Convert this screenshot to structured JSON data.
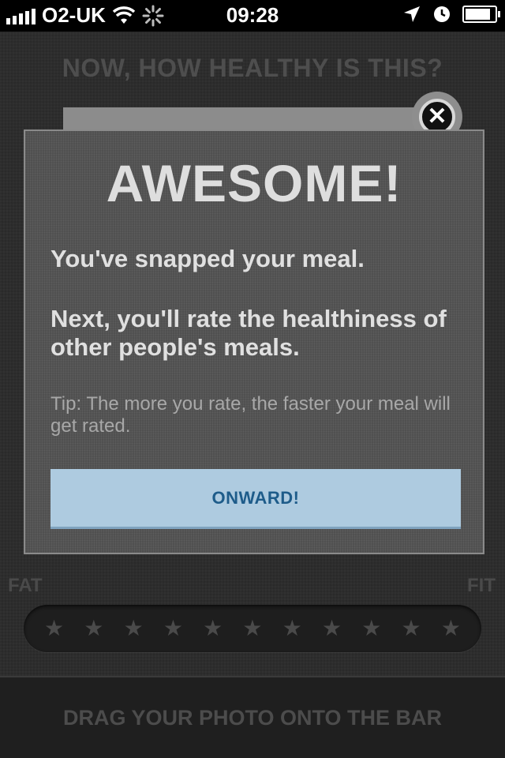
{
  "status_bar": {
    "carrier": "O2-UK",
    "time": "09:28",
    "icons": [
      "signal-bars-icon",
      "wifi-icon",
      "activity-spinner-icon",
      "location-arrow-icon",
      "alarm-clock-icon",
      "battery-icon"
    ]
  },
  "screen": {
    "heading": "NOW, HOW HEALTHY IS THIS?",
    "rating": {
      "left_label": "FAT",
      "right_label": "FIT",
      "star_glyph": "★",
      "star_count": 11
    },
    "bottom_instruction": "DRAG YOUR PHOTO ONTO THE BAR"
  },
  "modal": {
    "title": "AWESOME!",
    "message_1": "You've snapped your meal.",
    "message_2": "Next, you'll rate the healthiness of other people's meals.",
    "tip": "Tip: The more you rate, the faster your meal will get rated.",
    "button_label": "ONWARD!"
  },
  "colors": {
    "button_bg": "#aecbe0",
    "button_text": "#1e5c8a",
    "modal_bg": "#555555"
  }
}
